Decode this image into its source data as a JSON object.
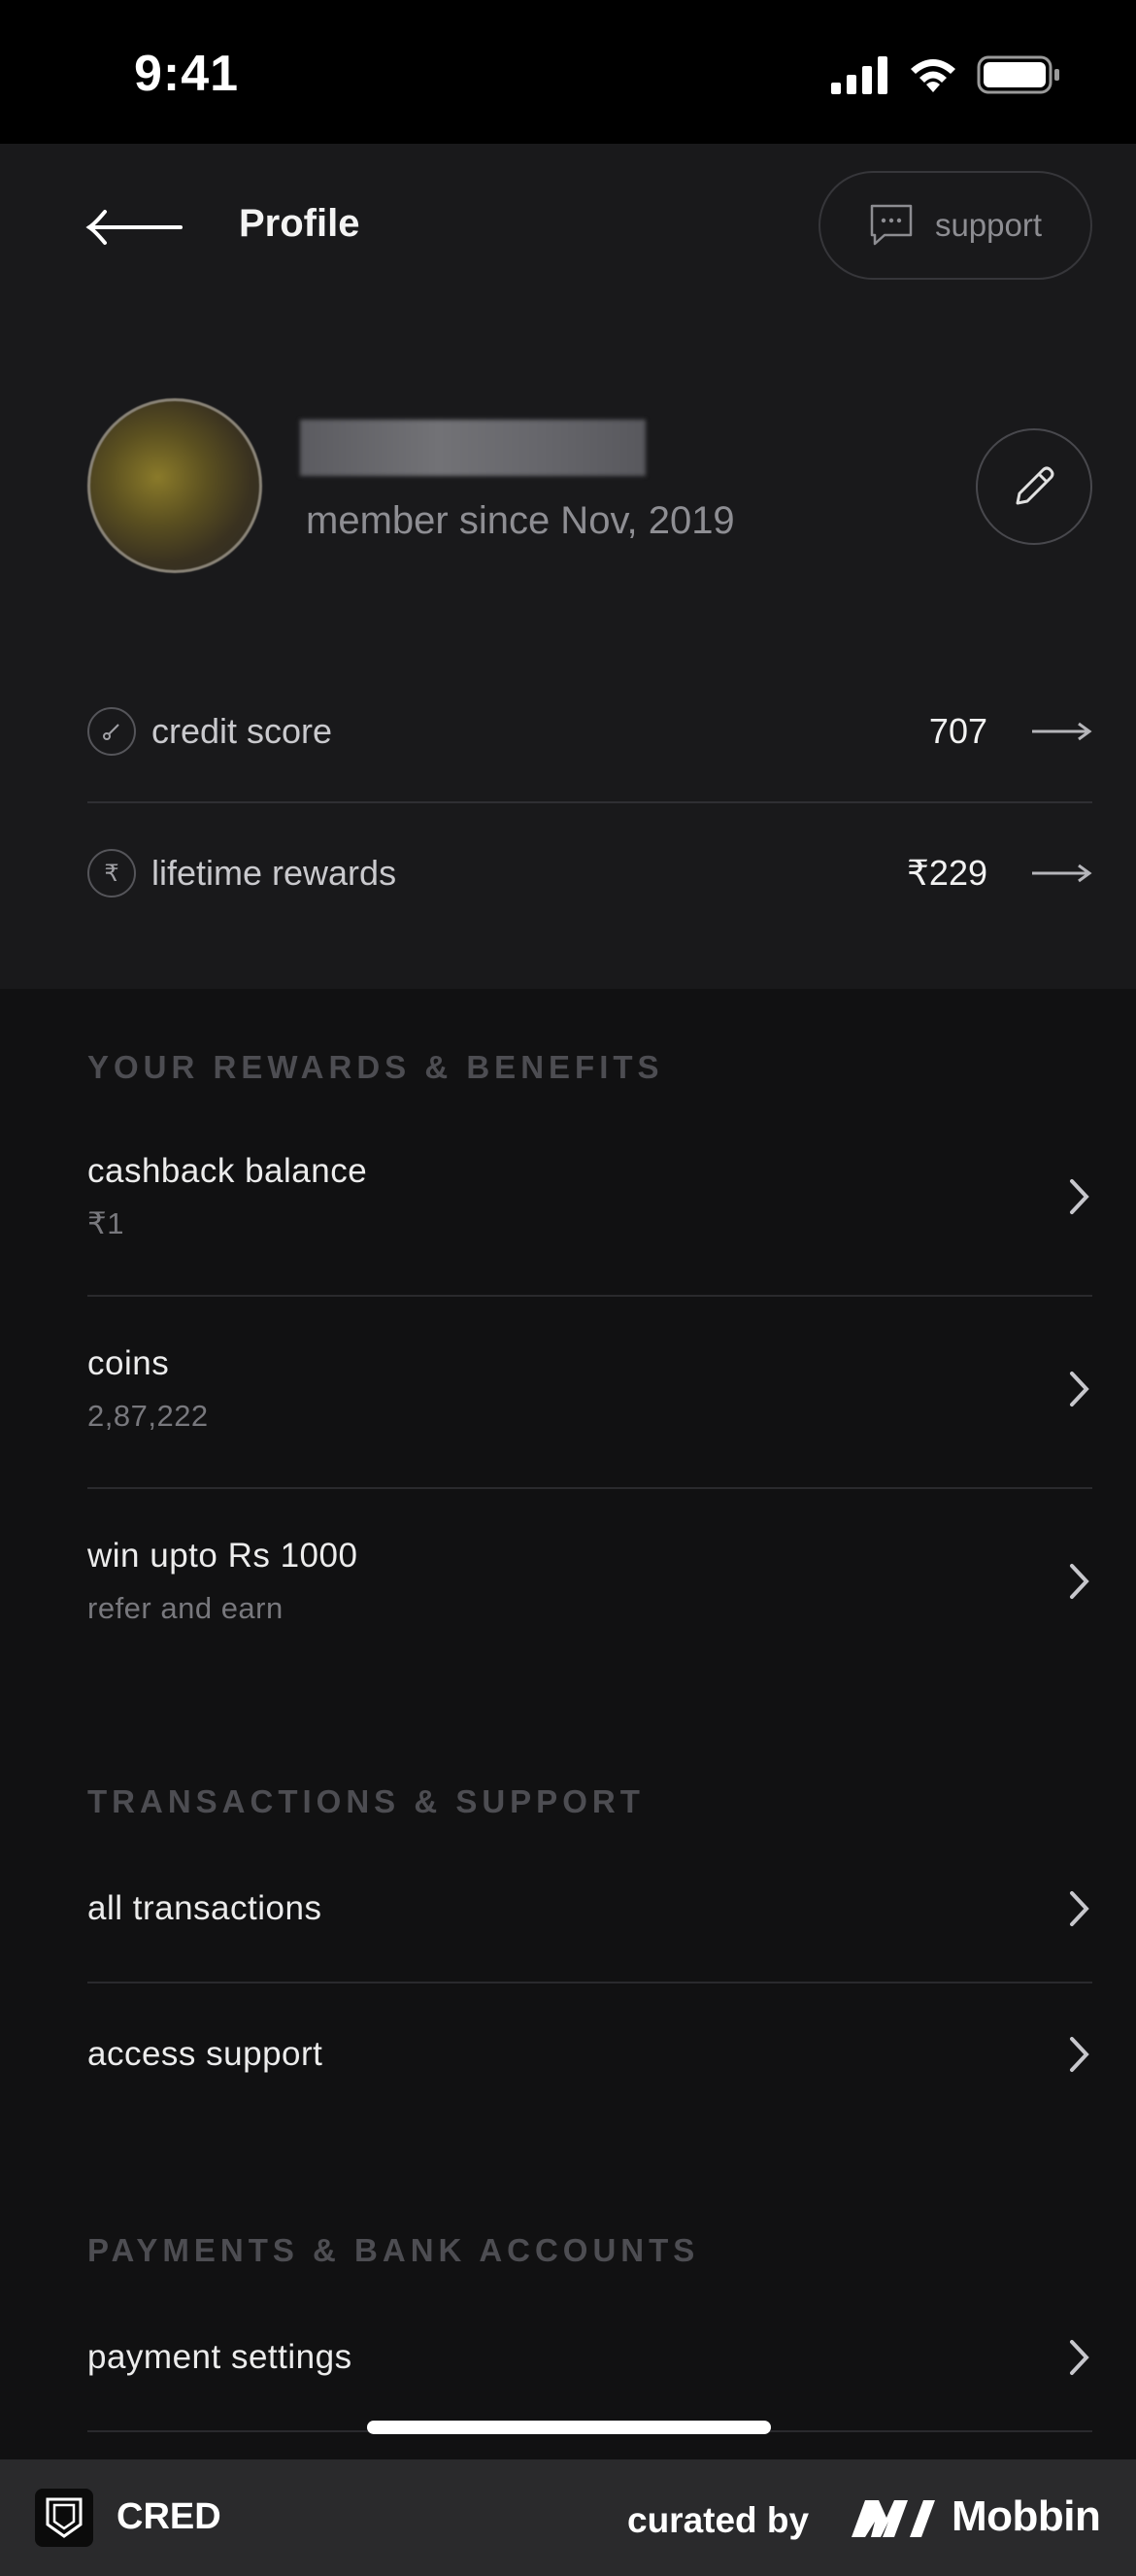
{
  "status_bar": {
    "time": "9:41"
  },
  "header": {
    "title": "Profile",
    "support_label": "support"
  },
  "profile": {
    "member_since": "member since Nov, 2019"
  },
  "stats": [
    {
      "label": "credit score",
      "value": "707",
      "icon": "gauge-icon"
    },
    {
      "label": "lifetime rewards",
      "value": "₹229",
      "icon": "rupee-icon"
    }
  ],
  "sections": {
    "rewards": {
      "heading": "YOUR REWARDS & BENEFITS",
      "items": [
        {
          "title": "cashback balance",
          "sub": "₹1"
        },
        {
          "title": "coins",
          "sub": "2,87,222"
        },
        {
          "title": "win upto Rs 1000",
          "sub": "refer and earn"
        }
      ]
    },
    "transactions": {
      "heading": "TRANSACTIONS & SUPPORT",
      "items": [
        {
          "title": "all transactions"
        },
        {
          "title": "access support"
        }
      ]
    },
    "payments": {
      "heading": "PAYMENTS & BANK ACCOUNTS",
      "items": [
        {
          "title": "payment settings"
        }
      ]
    }
  },
  "footer": {
    "app_name": "CRED",
    "curated_by": "curated by",
    "brand": "Mobbin"
  },
  "colors": {
    "background": "#111112",
    "panel": "#19191b",
    "heading": "#4d4d52"
  }
}
